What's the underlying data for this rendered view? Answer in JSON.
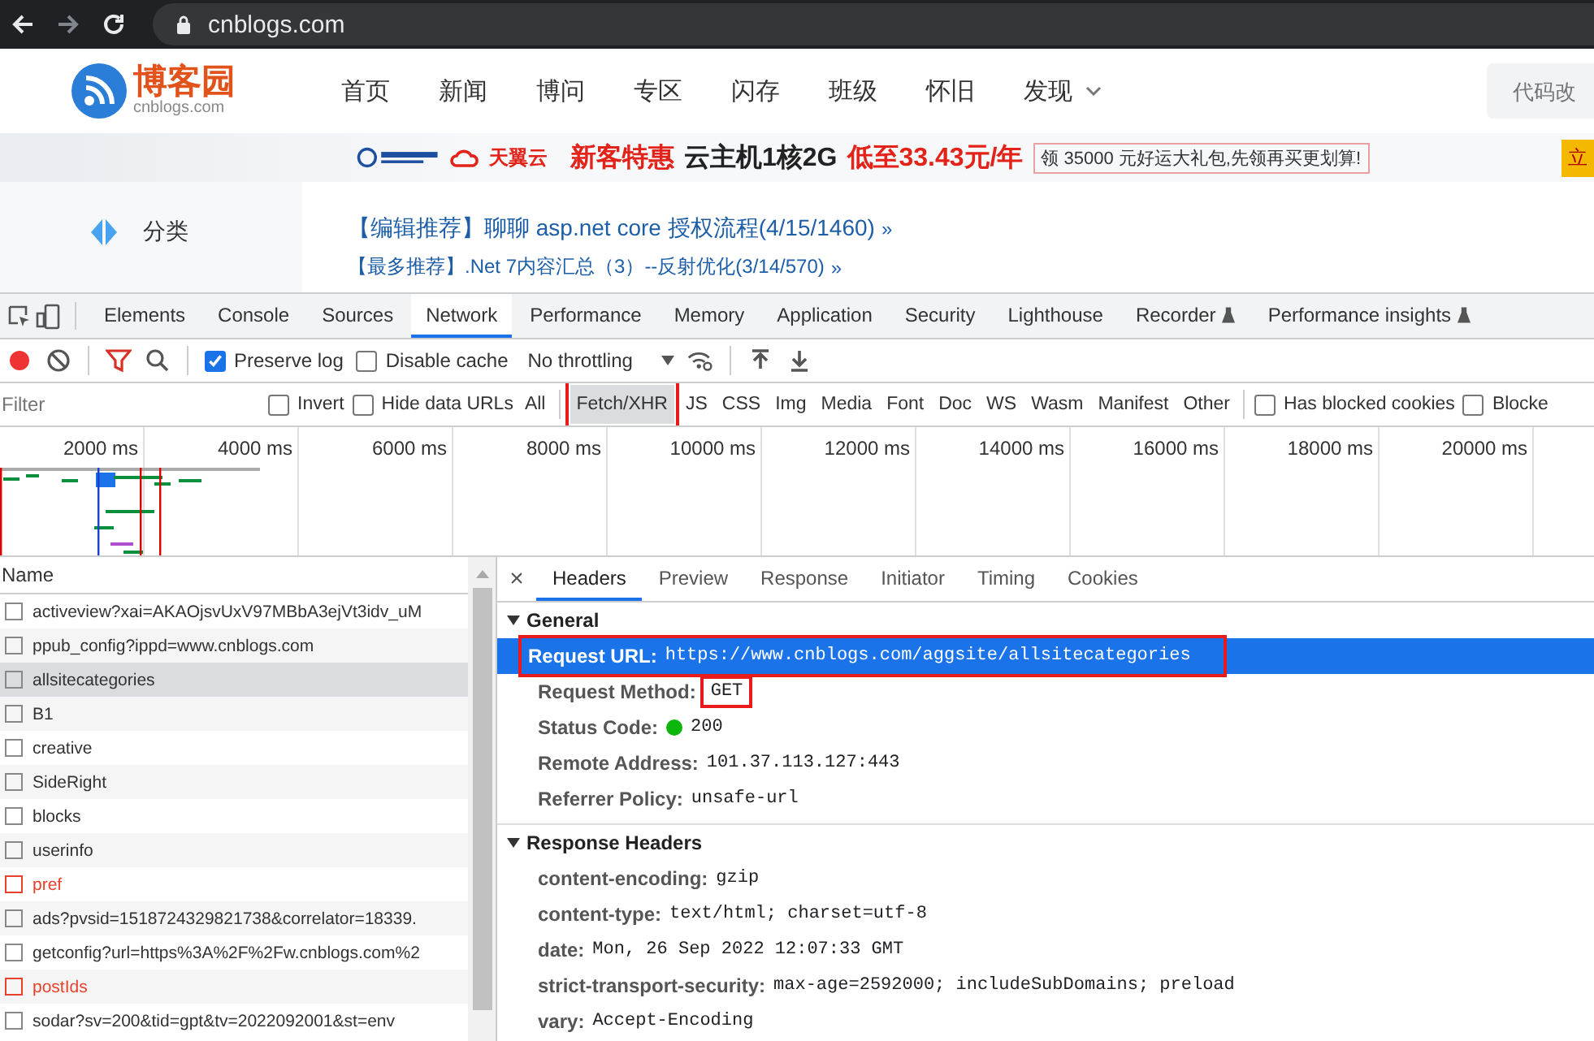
{
  "browser": {
    "url": "cnblogs.com"
  },
  "site": {
    "logo": "博客园",
    "logo_sub": "cnblogs.com",
    "nav": [
      "首页",
      "新闻",
      "博问",
      "专区",
      "闪存",
      "班级",
      "怀旧",
      "发现"
    ],
    "search": {
      "placeholder": "代码改"
    }
  },
  "banner": {
    "brand": "天翼云",
    "promo": "新客特惠",
    "product": "云主机1核2G",
    "price": "低至33.43元/年",
    "gift": "领 35000 元好运大礼包,先领再买更划算!",
    "button": "立"
  },
  "sidebar": {
    "items": [
      "分类"
    ]
  },
  "news": [
    {
      "tag": "【编辑推荐】",
      "title": "聊聊 asp.net core 授权流程(4/15/1460)",
      "more": "»",
      "kind": "large"
    },
    {
      "tag": "【最多推荐】",
      "title": ".Net 7内容汇总（3）--反射优化(3/14/570)",
      "more": "»",
      "kind": "small"
    }
  ],
  "devtools": {
    "tabs": [
      {
        "label": "Elements",
        "selected": false,
        "experimental": false
      },
      {
        "label": "Console",
        "selected": false,
        "experimental": false
      },
      {
        "label": "Sources",
        "selected": false,
        "experimental": false
      },
      {
        "label": "Network",
        "selected": true,
        "experimental": false
      },
      {
        "label": "Performance",
        "selected": false,
        "experimental": false
      },
      {
        "label": "Memory",
        "selected": false,
        "experimental": false
      },
      {
        "label": "Application",
        "selected": false,
        "experimental": false
      },
      {
        "label": "Security",
        "selected": false,
        "experimental": false
      },
      {
        "label": "Lighthouse",
        "selected": false,
        "experimental": false
      },
      {
        "label": "Recorder",
        "selected": false,
        "experimental": true
      },
      {
        "label": "Performance insights",
        "selected": false,
        "experimental": true
      }
    ],
    "toolbar": {
      "recording": true,
      "filter_active": true,
      "options": [
        {
          "label": "Preserve log",
          "checked": true
        },
        {
          "label": "Disable cache",
          "checked": false
        }
      ],
      "throttling": "No throttling"
    },
    "filter": {
      "placeholder": "Filter",
      "options": [
        {
          "label": "Invert",
          "checked": false
        },
        {
          "label": "Hide data URLs",
          "checked": false
        }
      ],
      "types": [
        {
          "label": "All",
          "selected": false,
          "highlighted": false
        },
        {
          "label": "Fetch/XHR",
          "selected": true,
          "highlighted": true
        },
        {
          "label": "JS",
          "selected": false,
          "highlighted": false
        },
        {
          "label": "CSS",
          "selected": false,
          "highlighted": false
        },
        {
          "label": "Img",
          "selected": false,
          "highlighted": false
        },
        {
          "label": "Media",
          "selected": false,
          "highlighted": false
        },
        {
          "label": "Font",
          "selected": false,
          "highlighted": false
        },
        {
          "label": "Doc",
          "selected": false,
          "highlighted": false
        },
        {
          "label": "WS",
          "selected": false,
          "highlighted": false
        },
        {
          "label": "Wasm",
          "selected": false,
          "highlighted": false
        },
        {
          "label": "Manifest",
          "selected": false,
          "highlighted": false
        },
        {
          "label": "Other",
          "selected": false,
          "highlighted": false
        }
      ],
      "extra": [
        {
          "label": "Has blocked cookies",
          "checked": false
        },
        {
          "label": "Blocke",
          "checked": false
        }
      ]
    },
    "overview": {
      "ticks": [
        "2000 ms",
        "4000 ms",
        "6000 ms",
        "8000 ms",
        "10000 ms",
        "12000 ms",
        "14000 ms",
        "16000 ms",
        "18000 ms",
        "20000 ms"
      ]
    },
    "requests": {
      "column": "Name",
      "rows": [
        {
          "name": "activeview?xai=AKAOjsvUxV97MBbA3ejVt3idv_uM",
          "selected": false,
          "error": false
        },
        {
          "name": "ppub_config?ippd=www.cnblogs.com",
          "selected": false,
          "error": false
        },
        {
          "name": "allsitecategories",
          "selected": true,
          "error": false
        },
        {
          "name": "B1",
          "selected": false,
          "error": false
        },
        {
          "name": "creative",
          "selected": false,
          "error": false
        },
        {
          "name": "SideRight",
          "selected": false,
          "error": false
        },
        {
          "name": "blocks",
          "selected": false,
          "error": false
        },
        {
          "name": "userinfo",
          "selected": false,
          "error": false
        },
        {
          "name": "pref",
          "selected": false,
          "error": true
        },
        {
          "name": "ads?pvsid=1518724329821738&correlator=18339.",
          "selected": false,
          "error": false
        },
        {
          "name": "getconfig?url=https%3A%2F%2Fw.cnblogs.com%2",
          "selected": false,
          "error": false
        },
        {
          "name": "postIds",
          "selected": false,
          "error": true
        },
        {
          "name": "sodar?sv=200&tid=gpt&tv=2022092001&st=env",
          "selected": false,
          "error": false
        }
      ]
    },
    "details": {
      "close": "×",
      "tabs": [
        {
          "label": "Headers",
          "selected": true
        },
        {
          "label": "Preview",
          "selected": false
        },
        {
          "label": "Response",
          "selected": false
        },
        {
          "label": "Initiator",
          "selected": false
        },
        {
          "label": "Timing",
          "selected": false
        },
        {
          "label": "Cookies",
          "selected": false
        }
      ],
      "sections": [
        {
          "title": "General",
          "expanded": true,
          "rows": [
            {
              "name": "Request URL:",
              "value": "https://www.cnblogs.com/aggsite/allsitecategories",
              "selected": true,
              "highlighted": true,
              "kind": "text"
            },
            {
              "name": "Request Method:",
              "value": "GET",
              "selected": false,
              "highlighted": true,
              "kind": "text"
            },
            {
              "name": "Status Code:",
              "value": "200",
              "selected": false,
              "highlighted": false,
              "kind": "status",
              "color": "#0cb60c"
            },
            {
              "name": "Remote Address:",
              "value": "101.37.113.127:443",
              "selected": false,
              "highlighted": false,
              "kind": "text"
            },
            {
              "name": "Referrer Policy:",
              "value": "unsafe-url",
              "selected": false,
              "highlighted": false,
              "kind": "text"
            }
          ]
        },
        {
          "title": "Response Headers",
          "expanded": true,
          "rows": [
            {
              "name": "content-encoding:",
              "value": "gzip",
              "selected": false,
              "highlighted": false,
              "kind": "text"
            },
            {
              "name": "content-type:",
              "value": "text/html; charset=utf-8",
              "selected": false,
              "highlighted": false,
              "kind": "text"
            },
            {
              "name": "date:",
              "value": "Mon, 26 Sep 2022 12:07:33 GMT",
              "selected": false,
              "highlighted": false,
              "kind": "text"
            },
            {
              "name": "strict-transport-security:",
              "value": "max-age=2592000; includeSubDomains; preload",
              "selected": false,
              "highlighted": false,
              "kind": "text"
            },
            {
              "name": "vary:",
              "value": "Accept-Encoding",
              "selected": false,
              "highlighted": false,
              "kind": "text"
            }
          ]
        }
      ]
    }
  }
}
